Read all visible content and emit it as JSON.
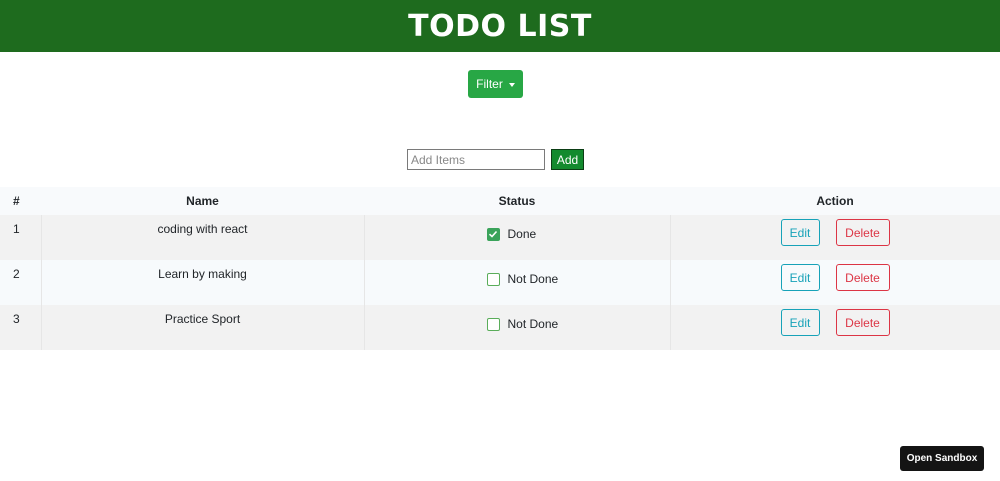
{
  "header": {
    "title": "TODO LIST"
  },
  "filter": {
    "label": "Filter"
  },
  "add_form": {
    "placeholder": "Add Items",
    "value": "",
    "button_label": "Add"
  },
  "table": {
    "columns": [
      "#",
      "Name",
      "Status",
      "Action"
    ],
    "rows": [
      {
        "index": "1",
        "name": "coding with react",
        "status": "Done",
        "done": true,
        "edit_label": "Edit",
        "delete_label": "Delete"
      },
      {
        "index": "2",
        "name": "Learn by making",
        "status": "Not Done",
        "done": false,
        "edit_label": "Edit",
        "delete_label": "Delete"
      },
      {
        "index": "3",
        "name": "Practice Sport",
        "status": "Not Done",
        "done": false,
        "edit_label": "Edit",
        "delete_label": "Delete"
      }
    ]
  },
  "sandbox": {
    "label": "Open Sandbox"
  },
  "colors": {
    "header_bg": "#1e6b1e",
    "filter_bg": "#28a745",
    "add_bg": "#138a2e",
    "edit": "#17a2b8",
    "delete": "#dc3545",
    "check": "#3aa35a"
  }
}
